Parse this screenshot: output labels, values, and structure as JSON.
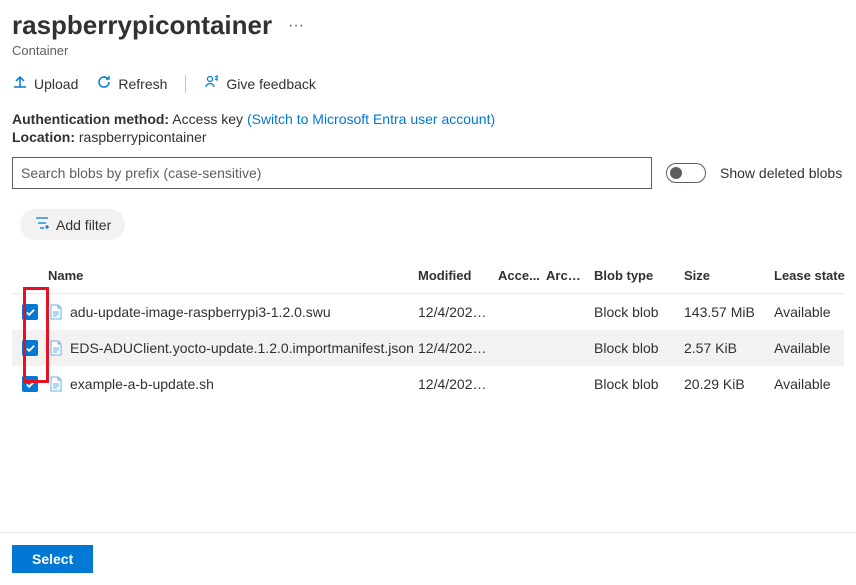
{
  "header": {
    "title": "raspberrypicontainer",
    "subtitle": "Container",
    "more_label": "···"
  },
  "toolbar": {
    "upload": "Upload",
    "refresh": "Refresh",
    "feedback": "Give feedback"
  },
  "info": {
    "auth_label": "Authentication method:",
    "auth_value": "Access key",
    "auth_switch": "(Switch to Microsoft Entra user account)",
    "location_label": "Location:",
    "location_value": "raspberrypicontainer"
  },
  "search": {
    "placeholder": "Search blobs by prefix (case-sensitive)",
    "toggle_label": "Show deleted blobs"
  },
  "filter": {
    "add_label": "Add filter"
  },
  "table": {
    "headers": {
      "name": "Name",
      "modified": "Modified",
      "access": "Acce...",
      "archive": "Archi...",
      "blobtype": "Blob type",
      "size": "Size",
      "lease": "Lease state"
    },
    "rows": [
      {
        "name": "adu-update-image-raspberrypi3-1.2.0.swu",
        "modified": "12/4/2024,...",
        "access": "",
        "archive": "",
        "blobtype": "Block blob",
        "size": "143.57 MiB",
        "lease": "Available",
        "checked": true
      },
      {
        "name": "EDS-ADUClient.yocto-update.1.2.0.importmanifest.json",
        "modified": "12/4/2024,...",
        "access": "",
        "archive": "",
        "blobtype": "Block blob",
        "size": "2.57 KiB",
        "lease": "Available",
        "checked": true
      },
      {
        "name": "example-a-b-update.sh",
        "modified": "12/4/2024,...",
        "access": "",
        "archive": "",
        "blobtype": "Block blob",
        "size": "20.29 KiB",
        "lease": "Available",
        "checked": true
      }
    ]
  },
  "footer": {
    "select": "Select"
  }
}
